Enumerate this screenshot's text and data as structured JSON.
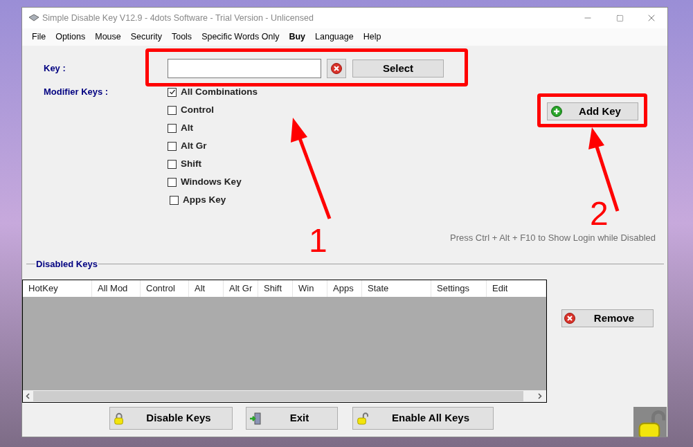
{
  "window": {
    "title": "Simple Disable Key V12.9 - 4dots Software - Trial Version - Unlicensed"
  },
  "menu": [
    {
      "label": "File",
      "emphasized": false
    },
    {
      "label": "Options",
      "emphasized": false
    },
    {
      "label": "Mouse",
      "emphasized": false
    },
    {
      "label": "Security",
      "emphasized": false
    },
    {
      "label": "Tools",
      "emphasized": false
    },
    {
      "label": "Specific Words Only",
      "emphasized": false
    },
    {
      "label": "Buy",
      "emphasized": true
    },
    {
      "label": "Language",
      "emphasized": false
    },
    {
      "label": "Help",
      "emphasized": false
    }
  ],
  "key": {
    "label": "Key :",
    "select_button": "Select"
  },
  "modifiers_label": "Modifier Keys :",
  "modifiers": [
    {
      "label": "All Combinations",
      "checked": true
    },
    {
      "label": "Control",
      "checked": false
    },
    {
      "label": "Alt",
      "checked": false
    },
    {
      "label": "Alt Gr",
      "checked": false
    },
    {
      "label": "Shift",
      "checked": false
    },
    {
      "label": "Windows Key",
      "checked": false
    },
    {
      "label": "Apps Key",
      "checked": false
    }
  ],
  "add_key_button": "Add Key",
  "hint": "Press Ctrl + Alt + F10 to Show Login while Disabled",
  "disabled_keys": {
    "title": "Disabled Keys",
    "columns": [
      "HotKey",
      "All Mod",
      "Control",
      "Alt",
      "Alt Gr",
      "Shift",
      "Win",
      "Apps",
      "State",
      "Settings",
      "Edit"
    ]
  },
  "remove_button": "Remove",
  "bottom_buttons": [
    {
      "label": "Disable Keys",
      "kind": "lock"
    },
    {
      "label": "Exit",
      "kind": "exit"
    },
    {
      "label": "Enable All Keys",
      "kind": "unlock"
    }
  ],
  "annotations": [
    {
      "label": "1"
    },
    {
      "label": "2"
    }
  ]
}
